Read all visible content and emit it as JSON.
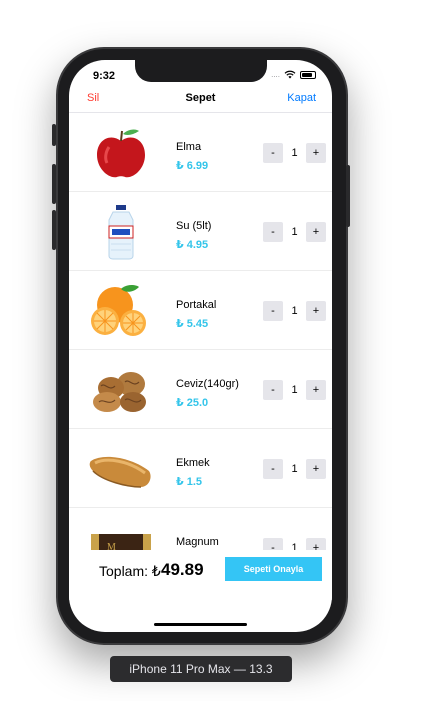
{
  "status": {
    "time": "9:32",
    "signal": "...."
  },
  "nav": {
    "left": "Sil",
    "title": "Sepet",
    "right": "Kapat"
  },
  "items": [
    {
      "name": "Elma",
      "price": "₺ 6.99",
      "qty": "1",
      "icon": "apple"
    },
    {
      "name": "Su (5lt)",
      "price": "₺ 4.95",
      "qty": "1",
      "icon": "water-bottle"
    },
    {
      "name": "Portakal",
      "price": "₺ 5.45",
      "qty": "1",
      "icon": "orange"
    },
    {
      "name": "Ceviz(140gr)",
      "price": "₺ 25.0",
      "qty": "1",
      "icon": "walnut"
    },
    {
      "name": "Ekmek",
      "price": "₺ 1.5",
      "qty": "1",
      "icon": "bread"
    },
    {
      "name": "Magnum",
      "price": "",
      "qty": "1",
      "icon": "ice-cream"
    }
  ],
  "stepper": {
    "minus": "-",
    "plus": "+"
  },
  "footer": {
    "total_label": "Toplam: ₺",
    "total_value": "49.89",
    "confirm": "Sepeti Onayla"
  },
  "device": {
    "label": "iPhone 11 Pro Max — 13.3"
  },
  "colors": {
    "accent": "#34c5ea",
    "delete": "#ff3b30",
    "link": "#007aff"
  }
}
